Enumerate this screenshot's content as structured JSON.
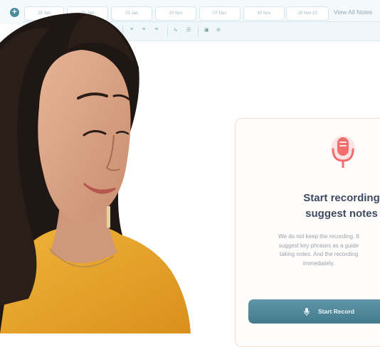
{
  "tabs": [
    "28 Jan",
    "31 Jan",
    "03 Jan",
    "20 Nov",
    "07 Dec",
    "30 Nov",
    "28 Nov 22"
  ],
  "view_all": "View All Notes",
  "toolbar": {
    "buttons": [
      "U",
      "S",
      "≡",
      "≡",
      "≡",
      "↳",
      "☰",
      "▣",
      "⊘"
    ]
  },
  "card": {
    "heading_line1": "Start recording",
    "heading_line2": "suggest notes",
    "body_line1": "We do not keep the recording. It",
    "body_line2": "suggest key phrases as a guide",
    "body_line3": "taking notes. And the recording",
    "body_line4": "immediately.",
    "button_label": "Start Record",
    "button_icon": "mic-icon"
  },
  "colors": {
    "accent": "#4d8c9c",
    "mic": "#f26d6d",
    "heading": "#3d4a5f"
  }
}
